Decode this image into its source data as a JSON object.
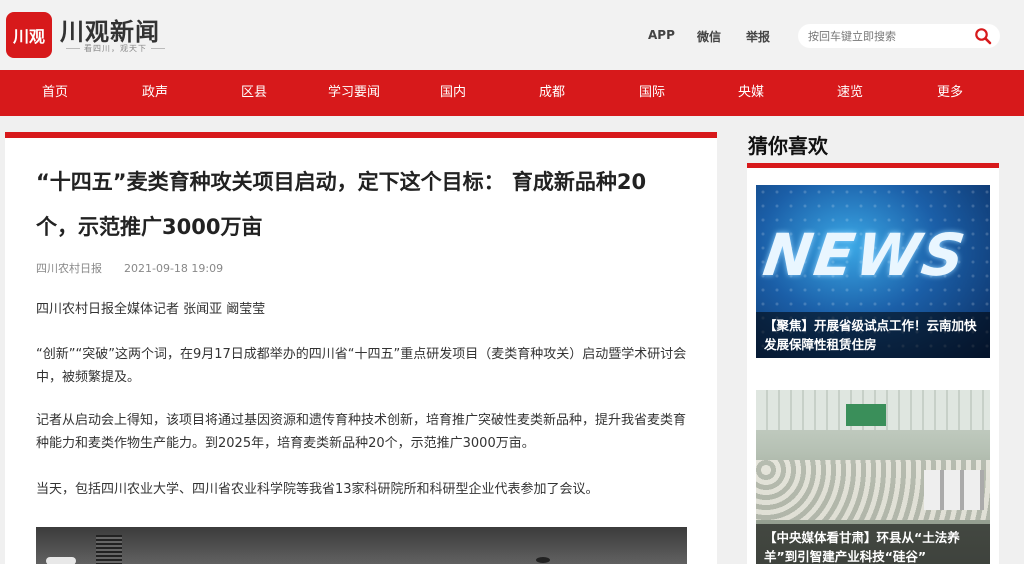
{
  "header": {
    "logo_mark": "川观",
    "logo_text": "川观新闻",
    "logo_slogan": "看四川，观天下",
    "links": [
      "APP",
      "微信",
      "举报"
    ],
    "search_placeholder": "按回车键立即搜索",
    "search_icon": "search-icon",
    "brand_color": "#d7191b"
  },
  "nav": {
    "items": [
      "首页",
      "政声",
      "区县",
      "学习要闻",
      "国内",
      "成都",
      "国际",
      "央媒",
      "速览",
      "更多"
    ]
  },
  "article": {
    "title": "“十四五”麦类育种攻关项目启动，定下这个目标： 育成新品种20个，示范推广3000万亩",
    "source": "四川农村日报",
    "time": "2021-09-18 19:09",
    "paragraphs": [
      "四川农村日报全媒体记者 张闻亚 阚莹莹",
      "“创新”“突破”这两个词，在9月17日成都举办的四川省“十四五”重点研发项目（麦类育种攻关）启动暨学术研讨会中，被频繁提及。",
      "记者从启动会上得知，该项目将通过基因资源和遗传育种技术创新，培育推广突破性麦类新品种，提升我省麦类育种能力和麦类作物生产能力。到2025年，培育麦类新品种20个，示范推广3000万亩。",
      "当天，包括四川农业大学、四川省农业科学院等我省13家科研院所和科研型企业代表参加了会议。"
    ]
  },
  "sidebar": {
    "title": "猜你喜欢",
    "cards": [
      {
        "image_text": "NEWS",
        "caption": "【聚焦】开展省级试点工作！云南加快发展保障性租赁住房"
      },
      {
        "caption": "【中央媒体看甘肃】环县从“土法养羊”到引智建产业科技“硅谷”"
      }
    ]
  }
}
